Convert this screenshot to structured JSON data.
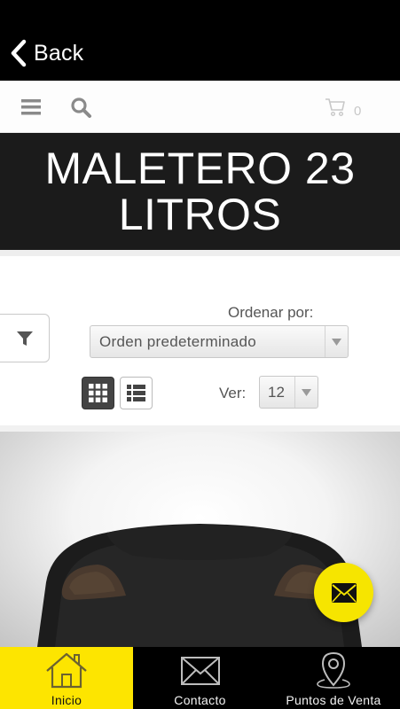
{
  "header": {
    "back_label": "Back"
  },
  "navbar": {
    "cart_count": "0"
  },
  "page": {
    "title_line1": "MALETERO 23",
    "title_line2": "LITROS"
  },
  "toolbar": {
    "order_label": "Ordenar por:",
    "order_value": "Orden predeterminado",
    "ver_label": "Ver:",
    "ver_value": "12"
  },
  "tabs": [
    {
      "label": "Inicio",
      "icon": "home-icon",
      "active": true
    },
    {
      "label": "Contacto",
      "icon": "envelope-icon",
      "active": false
    },
    {
      "label": "Puntos de Venta",
      "icon": "location-pin-icon",
      "active": false
    }
  ],
  "colors": {
    "accent_yellow": "#fde500",
    "banner_bg": "#1b1b1b",
    "topbar_bg": "#000000"
  }
}
